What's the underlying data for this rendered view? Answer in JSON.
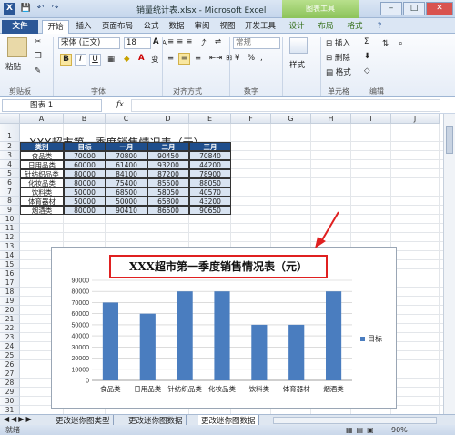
{
  "title": "销量统计表.xlsx - Microsoft Excel",
  "context_tab": "图表工具",
  "quick_access": [
    "💾",
    "↶",
    "↷"
  ],
  "window_buttons": [
    "–",
    "□",
    "✕"
  ],
  "tabs": [
    "文件",
    "开始",
    "插入",
    "页面布局",
    "公式",
    "数据",
    "审阅",
    "视图",
    "开发工具",
    "设计",
    "布局",
    "格式"
  ],
  "ribbon": {
    "paste": "粘贴",
    "font_name": "宋体 (正文)",
    "font_size": "18",
    "grow": "A",
    "shrink": "A",
    "bold": "B",
    "italic": "I",
    "underline": "U",
    "number_format": "常规",
    "percent": "%",
    "comma": ",",
    "styles": "样式",
    "insert": "插入",
    "delete": "删除",
    "format": "格式",
    "sigma": "Σ",
    "groups": [
      "剪贴板",
      "字体",
      "对齐方式",
      "数字",
      "单元格",
      "编辑"
    ]
  },
  "name_box": "图表 1",
  "fx": "fx",
  "columns": [
    "A",
    "B",
    "C",
    "D",
    "E",
    "F",
    "G",
    "H",
    "I",
    "J"
  ],
  "rows": [
    "1",
    "2",
    "3",
    "4",
    "5",
    "6",
    "7",
    "8",
    "9",
    "10",
    "11",
    "12",
    "13",
    "14",
    "15",
    "16",
    "17",
    "18",
    "19",
    "20",
    "21",
    "22",
    "23",
    "24",
    "25",
    "26",
    "27",
    "28",
    "29",
    "30",
    "31"
  ],
  "sheet_title": "XXX超市第一季度销售情况表（元）",
  "table": {
    "headers": [
      "类别",
      "目标",
      "一月",
      "二月",
      "三月"
    ],
    "rows": [
      [
        "食品类",
        "70000",
        "70800",
        "90450",
        "70840"
      ],
      [
        "日用品类",
        "60000",
        "61400",
        "93200",
        "44200"
      ],
      [
        "针纺织品类",
        "80000",
        "84100",
        "87200",
        "78900"
      ],
      [
        "化妆品类",
        "80000",
        "75400",
        "85500",
        "88050"
      ],
      [
        "饮料类",
        "50000",
        "68500",
        "58050",
        "40570"
      ],
      [
        "体育器材",
        "50000",
        "50000",
        "65800",
        "43200"
      ],
      [
        "烟酒类",
        "80000",
        "90410",
        "86500",
        "90650"
      ]
    ]
  },
  "sheet_tabs": [
    "更改迷你图类型",
    "更改迷你图数据",
    "更改迷你图数据"
  ],
  "status_left": "就绪",
  "zoom": "90%",
  "chart_data": {
    "type": "bar",
    "title": "XXX超市第一季度销售情况表（元）",
    "categories": [
      "食品类",
      "日用品类",
      "针纺织品类",
      "化妆品类",
      "饮料类",
      "体育器材",
      "烟酒类"
    ],
    "series": [
      {
        "name": "目标",
        "values": [
          70000,
          60000,
          80000,
          80000,
          50000,
          50000,
          80000
        ]
      }
    ],
    "ylim": [
      0,
      90000
    ],
    "yticks": [
      "0",
      "10000",
      "20000",
      "30000",
      "40000",
      "50000",
      "60000",
      "70000",
      "80000",
      "90000"
    ],
    "grid": true,
    "legend": "right",
    "color": "#4a7dbf"
  }
}
